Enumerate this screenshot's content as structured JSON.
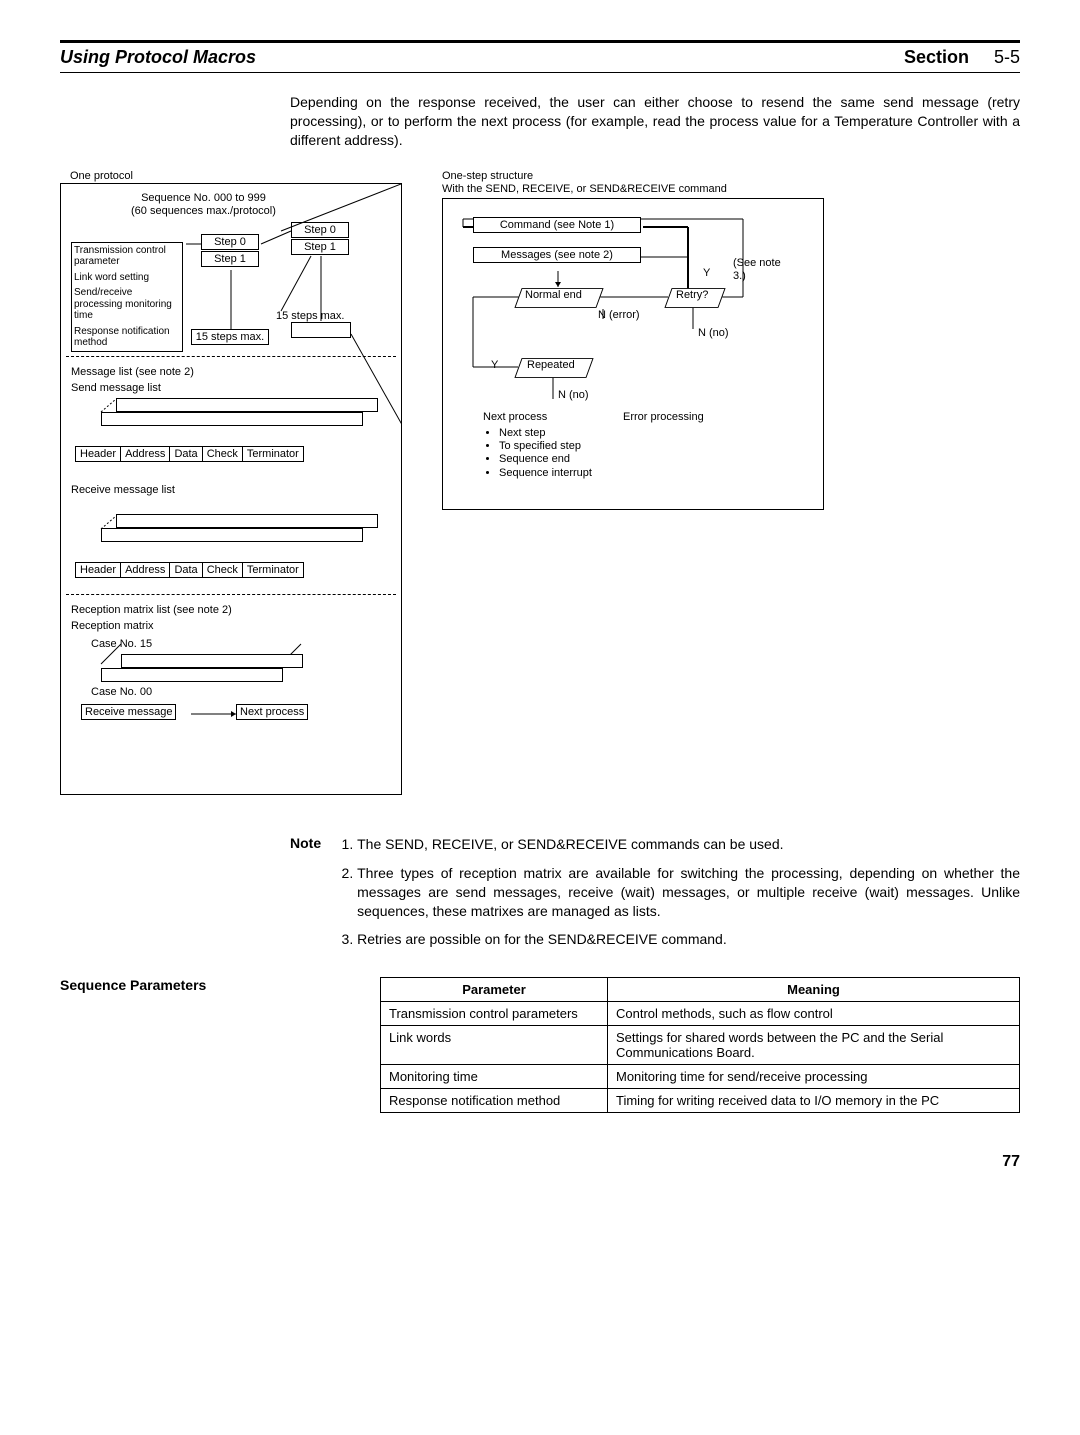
{
  "header": {
    "title": "Using Protocol Macros",
    "section_label": "Section",
    "section_num": "5-5"
  },
  "intro_para": "Depending on the response received, the user can either choose to resend the same send message (retry processing), or to perform the next process (for example, read the process value for a Temperature Controller with a different address).",
  "left_diagram": {
    "one_protocol": "One protocol",
    "seq_header1": "Sequence No. 000 to 999",
    "seq_header2": "(60 sequences max./protocol)",
    "params": [
      "Transmission control parameter",
      "Link word setting",
      "Send/receive processing monitoring time",
      "Response notification method"
    ],
    "step0": "Step 0",
    "step1": "Step 1",
    "step0b": "Step 0",
    "step1b": "Step 1",
    "steps_max": "15 steps max.",
    "steps_max2": "15 steps max.",
    "msg_list_label": "Message list (see note 2)",
    "send_list_label": "Send message list",
    "recv_list_label": "Receive message list",
    "msg_fields": [
      "Header",
      "Address",
      "Data",
      "Check",
      "Terminator"
    ],
    "reception_label": "Reception matrix list (see note 2)",
    "reception_matrix": "Reception matrix",
    "case15": "Case No. 15",
    "case00": "Case No. 00",
    "recv_msg": "Receive message",
    "next_proc": "Next process"
  },
  "right_diagram": {
    "title1": "One-step structure",
    "title2": "With the SEND, RECEIVE, or SEND&RECEIVE command",
    "command": "Command (see Note 1)",
    "messages": "Messages (see note 2)",
    "normal_end": "Normal end",
    "n_error": "N (error)",
    "retry": "Retry?",
    "y": "Y",
    "see_note3": "(See note 3.)",
    "n_no": "N (no)",
    "repeated": "Repeated",
    "y2": "Y",
    "n_no2": "N (no)",
    "next_process": "Next process",
    "error_proc": "Error processing",
    "bullets": [
      "Next step",
      "To specified step",
      "Sequence end",
      "Sequence interrupt"
    ]
  },
  "notes": {
    "label": "Note",
    "items": [
      "The SEND, RECEIVE, or SEND&RECEIVE commands can be used.",
      "Three types of reception matrix are available for switching the processing, depending on whether the messages are send messages, receive (wait) messages, or multiple receive (wait) messages. Unlike sequences, these matrixes are managed as lists.",
      "Retries are possible on for the SEND&RECEIVE command."
    ]
  },
  "seq_params": {
    "title": "Sequence Parameters",
    "header_param": "Parameter",
    "header_meaning": "Meaning",
    "rows": [
      {
        "p": "Transmission control parameters",
        "m": "Control methods, such as flow control"
      },
      {
        "p": "Link words",
        "m": "Settings for shared words between the PC and the Serial Communications Board."
      },
      {
        "p": "Monitoring time",
        "m": "Monitoring time for send/receive processing"
      },
      {
        "p": "Response notification method",
        "m": "Timing for writing received data to I/O memory in the PC"
      }
    ]
  },
  "page_number": "77"
}
